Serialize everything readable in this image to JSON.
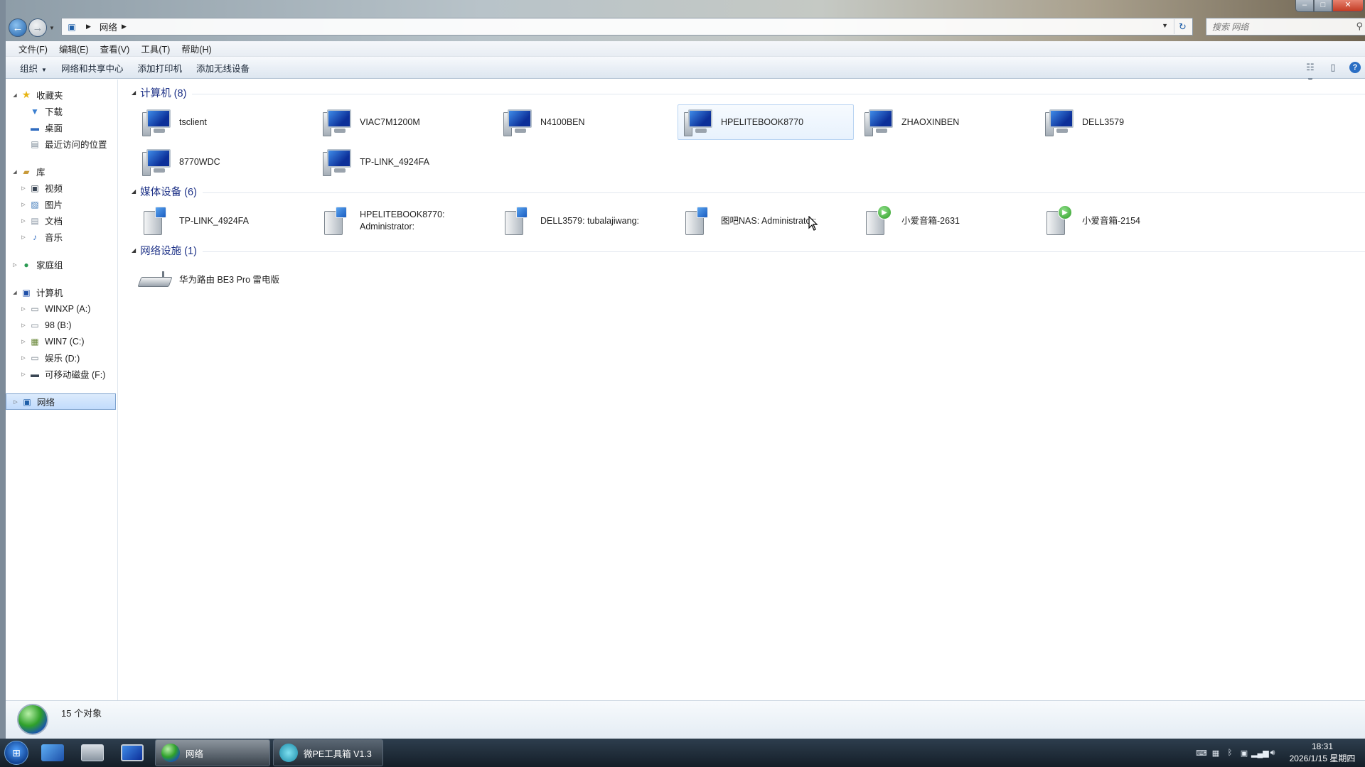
{
  "window": {
    "address": {
      "crumb": "网络"
    },
    "search_placeholder": "搜索 网络"
  },
  "menu": [
    "文件(F)",
    "编辑(E)",
    "查看(V)",
    "工具(T)",
    "帮助(H)"
  ],
  "toolbar": {
    "organize": "组织",
    "network_center": "网络和共享中心",
    "add_printer": "添加打印机",
    "add_wireless": "添加无线设备"
  },
  "nav": {
    "favorites": "收藏夹",
    "downloads": "下载",
    "desktop": "桌面",
    "recent": "最近访问的位置",
    "libraries": "库",
    "videos": "视频",
    "pictures": "图片",
    "documents": "文档",
    "music": "音乐",
    "homegroup": "家庭组",
    "computer": "计算机",
    "drive_a": "WINXP (A:)",
    "drive_b": "98 (B:)",
    "drive_c": "WIN7 (C:)",
    "drive_d": "娱乐 (D:)",
    "drive_f": "可移动磁盘 (F:)",
    "network": "网络"
  },
  "groups": {
    "computers": {
      "title": "计算机 (8)",
      "items": [
        "tsclient",
        "VIAC7M1200M",
        "N4100BEN",
        "HPELITEBOOK8770",
        "ZHAOXINBEN",
        "DELL3579",
        "8770WDC",
        "TP-LINK_4924FA"
      ]
    },
    "media": {
      "title": "媒体设备 (6)",
      "items": [
        {
          "line1": "TP-LINK_4924FA",
          "line2": ""
        },
        {
          "line1": "HPELITEBOOK8770:",
          "line2": "Administrator:"
        },
        {
          "line1": "DELL3579: tubalajiwang:",
          "line2": ""
        },
        {
          "line1": "图吧NAS: Administrator:",
          "line2": ""
        },
        {
          "line1": "小爱音箱-2631",
          "line2": ""
        },
        {
          "line1": "小爱音箱-2154",
          "line2": ""
        }
      ]
    },
    "infrastructure": {
      "title": "网络设施 (1)",
      "items": [
        "华为路由 BE3 Pro 雷电版"
      ]
    }
  },
  "details": {
    "count": "15 个对象"
  },
  "taskbar": {
    "task_network": "网络",
    "task_wepe": "微PE工具箱 V1.3",
    "time": "18:31",
    "date": "2026/1/15 星期四"
  }
}
